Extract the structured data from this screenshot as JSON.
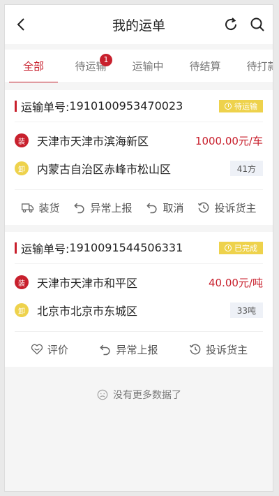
{
  "header": {
    "title": "我的运单",
    "back_icon": "chevron-left-icon",
    "refresh_icon": "refresh-icon",
    "search_icon": "search-icon"
  },
  "tabs": [
    {
      "label": "全部",
      "active": true
    },
    {
      "label": "待运输",
      "badge": "1"
    },
    {
      "label": "运输中"
    },
    {
      "label": "待结算"
    },
    {
      "label": "待打款"
    }
  ],
  "orders": [
    {
      "order_label": "运输单号:",
      "order_no": "1910100953470023",
      "status": "待运输",
      "load_tag": "装",
      "load_address": "天津市天津市滨海新区",
      "price": "1000.00元/车",
      "unload_tag": "卸",
      "unload_address": "内蒙古自治区赤峰市松山区",
      "quantity": "41方",
      "actions": [
        {
          "label": "装货",
          "icon": "truck-icon"
        },
        {
          "label": "异常上报",
          "icon": "undo-icon"
        },
        {
          "label": "取消",
          "icon": "undo-icon"
        },
        {
          "label": "投诉货主",
          "icon": "history-icon"
        }
      ]
    },
    {
      "order_label": "运输单号:",
      "order_no": "1910091544506331",
      "status": "已完成",
      "load_tag": "装",
      "load_address": "天津市天津市和平区",
      "price": "40.00元/吨",
      "unload_tag": "卸",
      "unload_address": "北京市北京市东城区",
      "quantity": "33吨",
      "actions": [
        {
          "label": "评价",
          "icon": "heart-icon"
        },
        {
          "label": "异常上报",
          "icon": "undo-icon"
        },
        {
          "label": "投诉货主",
          "icon": "history-icon"
        }
      ]
    }
  ],
  "footer": {
    "no_more_text": "没有更多数据了",
    "icon": "sad-face-icon"
  },
  "colors": {
    "accent": "#c8202d",
    "status_bg": "#eed24c"
  }
}
